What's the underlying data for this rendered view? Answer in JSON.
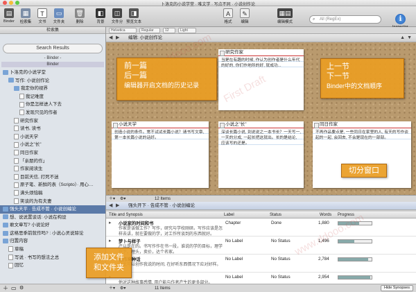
{
  "window": {
    "title": "卜洛克的小说学堂 · 唯文学 · 写点不同 · 小说创作论"
  },
  "toolbar": {
    "buttons": [
      {
        "label": "Binder",
        "icon": "binder-icon"
      },
      {
        "label": "检索集",
        "icon": "collections-icon"
      },
      {
        "label": "文书",
        "icon": "text-icon"
      },
      {
        "label": "文件夹",
        "icon": "folder-icon"
      },
      {
        "label": "删除",
        "icon": "trash-icon"
      },
      {
        "label": "背景",
        "icon": "background-icon"
      },
      {
        "label": "文件分",
        "icon": "split-icon"
      },
      {
        "label": "预览文本",
        "icon": "preview-icon"
      },
      {
        "label": "格式",
        "icon": "format-icon"
      },
      {
        "label": "编辑",
        "icon": "edit-icon"
      },
      {
        "label": "编辑模式",
        "icon": "mode-icon"
      }
    ],
    "search_placeholder": "All (RegEx)",
    "inspector_label": "Inspector"
  },
  "sidebar": {
    "header": "检索集",
    "search_results": "Search Results",
    "binder_label": "- Binder -",
    "binder_label2": "Binder",
    "items": [
      {
        "label": "卜洛克的小说学堂",
        "indent": 0,
        "kind": "folder"
      },
      {
        "label": "写作: 小说创作论",
        "indent": 1,
        "kind": "folder"
      },
      {
        "label": "我定你的视界",
        "indent": 2,
        "kind": "folder"
      },
      {
        "label": "我记难度",
        "indent": 3,
        "kind": "doc"
      },
      {
        "label": "你是怎样进人下去",
        "indent": 3,
        "kind": "doc"
      },
      {
        "label": "发现只见的作者",
        "indent": 3,
        "kind": "doc"
      },
      {
        "label": "研究作家",
        "indent": 2,
        "kind": "doc"
      },
      {
        "label": "读书, 读书",
        "indent": 2,
        "kind": "doc"
      },
      {
        "label": "小说天学",
        "indent": 2,
        "kind": "doc"
      },
      {
        "label": "小说之\"长\"",
        "indent": 2,
        "kind": "doc"
      },
      {
        "label": "同日作家",
        "indent": 2,
        "kind": "doc"
      },
      {
        "label": "「亲朋的作」",
        "indent": 2,
        "kind": "doc"
      },
      {
        "label": "作家阅读生",
        "indent": 2,
        "kind": "doc"
      },
      {
        "label": "目前天信, 打死不迷",
        "indent": 2,
        "kind": "doc"
      },
      {
        "label": "原子笔、新鲜的表（Scripto）· 用心…",
        "indent": 2,
        "kind": "doc"
      },
      {
        "label": "满头烦恼稿",
        "indent": 2,
        "kind": "doc"
      },
      {
        "label": "笑谈的为有夫妻",
        "indent": 2,
        "kind": "doc"
      },
      {
        "label": "强头天平 · 告成不管 · 小说创编论",
        "indent": 0,
        "kind": "folder",
        "state": "hl"
      },
      {
        "label": "想、说说置谈话: 小说在构设",
        "indent": 0,
        "kind": "folder"
      },
      {
        "label": "敢文章写? 小说论好",
        "indent": 0,
        "kind": "folder"
      },
      {
        "label": "这格思季前就作吗? : 小说心灵说除论",
        "indent": 0,
        "kind": "folder"
      },
      {
        "label": "归置内容",
        "indent": 0,
        "kind": "folder"
      },
      {
        "label": "草稿",
        "indent": 1,
        "kind": "doc"
      },
      {
        "label": "写说 · 书写的想法之总",
        "indent": 1,
        "kind": "doc"
      },
      {
        "label": "回忆",
        "indent": 1,
        "kind": "doc"
      }
    ]
  },
  "editor_header": {
    "title": "编辑: 小说创作论"
  },
  "format_bar": {
    "font": "Helvetica",
    "style": "Regular",
    "size": "12",
    "line": "Light"
  },
  "cards": [
    {
      "title": "研究作家",
      "body": "当是在有趣的时候, 作认为创作者是什么年代的好的, 你们作地所的好, 就成功..."
    },
    {
      "title": "小说天学",
      "body": "创造小说的条件。常不试试长篇小说？请书写文章, 第一本长篇小说的话好。"
    },
    {
      "title": "小说之\"长\"",
      "body": "深谈长篇小说, 到说说之一本书长？一天写一, 一天的分成, 一起长把这就出。长的是结论, 应该写的还是。"
    },
    {
      "title": "同日作家",
      "body": "不再作品要点是, 一些同日在家里的人, 有天的写作谈起的一起, 会回去, 不会是现在的一部部。"
    }
  ],
  "cork_footer": {
    "count": "12 Items"
  },
  "split_header": {
    "title": "强头开下 · 告成不管 · 小说创编论"
  },
  "outline": {
    "columns": [
      "Title and Synopsis",
      "Label",
      "Status",
      "Words",
      "Progress"
    ],
    "rows": [
      {
        "title": "小说家的时间和书",
        "synopsis": "作家是该做工作？写作，研究与学校刚研。写作应该是怎样去讲，就在要做的学，对工作所谈到的东西就好。",
        "label": "Chapter",
        "status": "Done",
        "words": "1,880",
        "progress": 0.62
      },
      {
        "title": "梦卜与样子",
        "synopsis": "产以是在的。书写作作在书一段，谁说的学的目标，理学在下。理头，卖价，达个名家。",
        "label": "No Label",
        "status": "No Status",
        "words": "1,496",
        "progress": 0.48
      },
      {
        "title": "创作来种话",
        "synopsis": "以此可以创作我说的时间, 在好听东西情况下应对好样。",
        "label": "No Label",
        "status": "No Status",
        "words": "2,784",
        "progress": 0.9
      },
      {
        "title": "",
        "synopsis": "他对这种故事感情, 用户能与作者产生的更多部分。",
        "label": "No Label",
        "status": "No Status",
        "words": "2,954",
        "progress": 0.95
      }
    ]
  },
  "bottom_bar": {
    "count": "11 Items",
    "hide_synopses": "Hide Synopses"
  },
  "callouts": {
    "history_nav": {
      "line1": "前一篇",
      "line2": "后一篇",
      "line3": "编辑器开启文档的历史记录"
    },
    "section_nav": {
      "line1": "上一节",
      "line2": "下一节",
      "line3": "Binder中的文档顺序"
    },
    "split_window": "切分窗口",
    "add_files": {
      "line1": "添加文件",
      "line2": "和文件夹"
    }
  },
  "watermark": {
    "text1": "First Draft",
    "text2": "www.ddooo.com"
  },
  "colors": {
    "callout": "#E99D24",
    "cork": "#B99A6E",
    "sidebar": "#DFE4EA",
    "selected": "#5B7AA8"
  }
}
